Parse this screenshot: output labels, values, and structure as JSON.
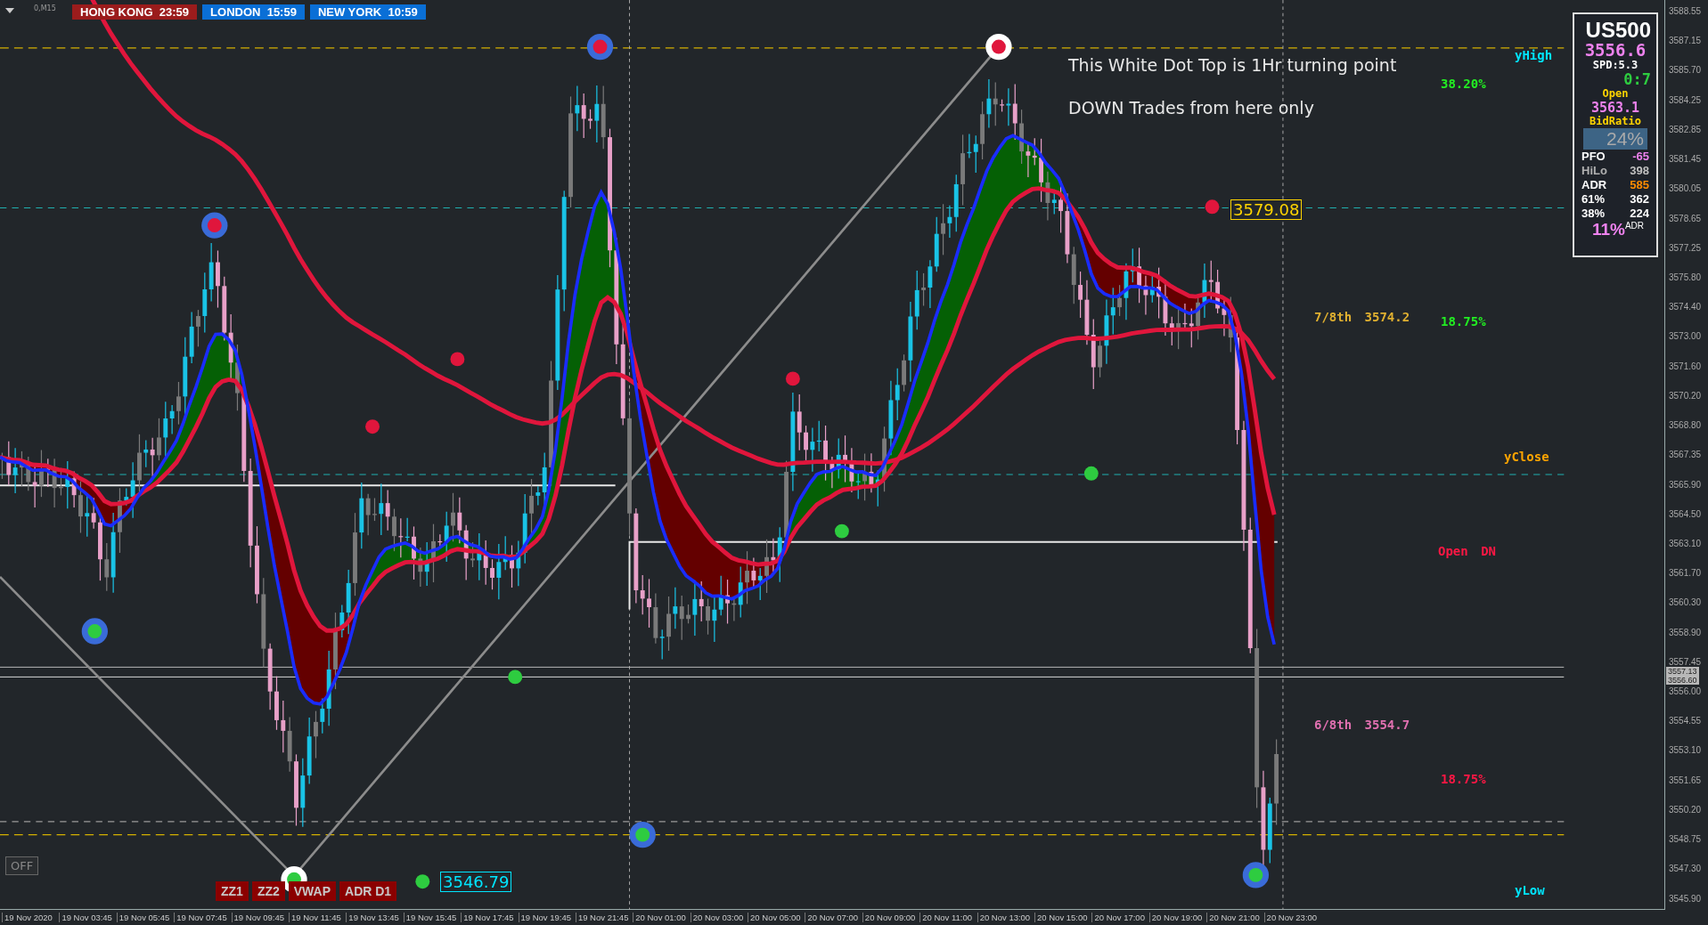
{
  "symbol_label": "0,M15",
  "session_clocks": [
    {
      "city": "HONG KONG",
      "time": "23:59",
      "color": "#9b1c1c"
    },
    {
      "city": "LONDON",
      "time": "15:59",
      "color": "#0a6fd6"
    },
    {
      "city": "NEW YORK",
      "time": "10:59",
      "color": "#0a6fd6"
    }
  ],
  "annotation": [
    "This White Dot Top is 1Hr turning point",
    "DOWN Trades from here only"
  ],
  "level_labels": [
    {
      "text": "yHigh",
      "color": "#00e5ff"
    },
    {
      "text": "38.20%",
      "color": "#22ee22"
    },
    {
      "text": "7/8th 3574.2",
      "color": "#e0b030"
    },
    {
      "text": "18.75%",
      "color": "#22ee22"
    },
    {
      "text": "yClose",
      "color": "#ffa500"
    },
    {
      "text": "Open DN",
      "color": "#ff1744"
    },
    {
      "text": "6/8th 3554.7",
      "color": "#e070b0"
    },
    {
      "text": "18.75%",
      "color": "#ff1744"
    },
    {
      "text": "yLow",
      "color": "#00e5ff"
    }
  ],
  "price_tags": [
    {
      "text": "3579.08",
      "color": "#ffd400"
    },
    {
      "text": "3546.79",
      "color": "#00e5ff"
    }
  ],
  "off_button": "OFF",
  "indicator_buttons": [
    "ZZ1",
    "ZZ2",
    "VWAP",
    "ADR D1"
  ],
  "info_panel": {
    "symbol": "US500",
    "price": "3556.6",
    "spread": "SPD:5.3",
    "counter": "0:7",
    "open_label": "Open",
    "open_value": "3563.1",
    "bid_ratio_label": "BidRatio",
    "bid_ratio": "24%",
    "rows": [
      {
        "label": "PFO",
        "value": "-65",
        "color": "#ee82ee",
        "muted": false
      },
      {
        "label": "HiLo",
        "value": "398",
        "color": "#c0c0c0",
        "muted": true
      },
      {
        "label": "ADR",
        "value": "585",
        "color": "#ff8c00",
        "muted": false
      },
      {
        "label": "61%",
        "value": "362",
        "color": "#ffffff",
        "muted": false
      },
      {
        "label": "38%",
        "value": "224",
        "color": "#ffffff",
        "muted": false
      }
    ],
    "adr_percent": "11%",
    "adr_suffix": "ADR"
  },
  "price_axis": {
    "labels": [
      "3588.55",
      "3587.15",
      "3585.70",
      "3584.25",
      "3582.85",
      "3581.45",
      "3580.05",
      "3578.65",
      "3577.25",
      "3575.80",
      "3574.40",
      "3573.00",
      "3571.60",
      "3570.20",
      "3568.80",
      "3567.35",
      "3565.90",
      "3564.50",
      "3563.10",
      "3561.70",
      "3560.30",
      "3558.90",
      "3557.45",
      "3556.00",
      "3554.55",
      "3553.10",
      "3551.65",
      "3550.20",
      "3548.75",
      "3547.30",
      "3545.90"
    ],
    "current_tags": [
      "3557.13",
      "3556.60"
    ]
  },
  "time_axis": {
    "labels": [
      "19 Nov 2020",
      "19 Nov 03:45",
      "19 Nov 05:45",
      "19 Nov 07:45",
      "19 Nov 09:45",
      "19 Nov 11:45",
      "19 Nov 13:45",
      "19 Nov 15:45",
      "19 Nov 17:45",
      "19 Nov 19:45",
      "19 Nov 21:45",
      "20 Nov 01:00",
      "20 Nov 03:00",
      "20 Nov 05:00",
      "20 Nov 07:00",
      "20 Nov 09:00",
      "20 Nov 11:00",
      "20 Nov 13:00",
      "20 Nov 15:00",
      "20 Nov 17:00",
      "20 Nov 19:00",
      "20 Nov 21:00",
      "20 Nov 23:00"
    ]
  }
}
